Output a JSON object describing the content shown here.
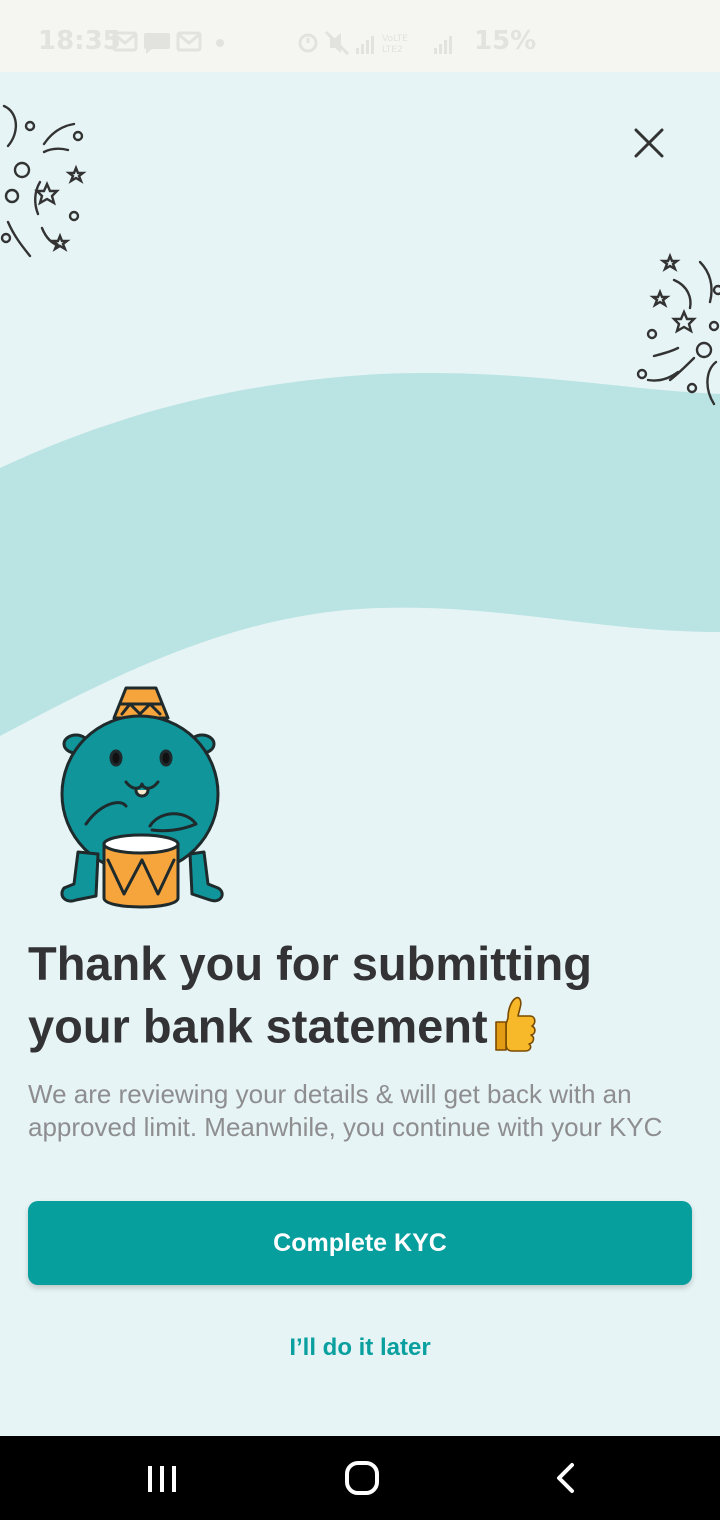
{
  "status_bar": {
    "time": "18:35",
    "battery": "15%",
    "notification_icons": [
      "gmail-icon",
      "message-icon",
      "gmail-icon",
      "dot-icon"
    ],
    "system_icons": [
      "alarm-icon",
      "mute-icon",
      "signal-icon",
      "volte-icon",
      "signal-icon"
    ]
  },
  "dialog": {
    "close_icon": "close-icon",
    "headline_line1": "Thank you for submitting",
    "headline_line2": "your bank statement",
    "headline_emoji": "thumbs-up-icon",
    "description": "We are reviewing your details & will get back with an approved limit. Meanwhile, you continue with your KYC",
    "primary_button": "Complete KYC",
    "secondary_link": "I’ll do it later"
  },
  "colors": {
    "background": "#E6F4F5",
    "wave": "#BAE3E3",
    "primary": "#079E9E",
    "headline": "#333336",
    "body_text": "#8E8E90",
    "mascot_body": "#10959A",
    "mascot_accent": "#F6A43C"
  },
  "nav_bar": {
    "items": [
      "recent-apps-icon",
      "home-icon",
      "back-icon"
    ]
  }
}
